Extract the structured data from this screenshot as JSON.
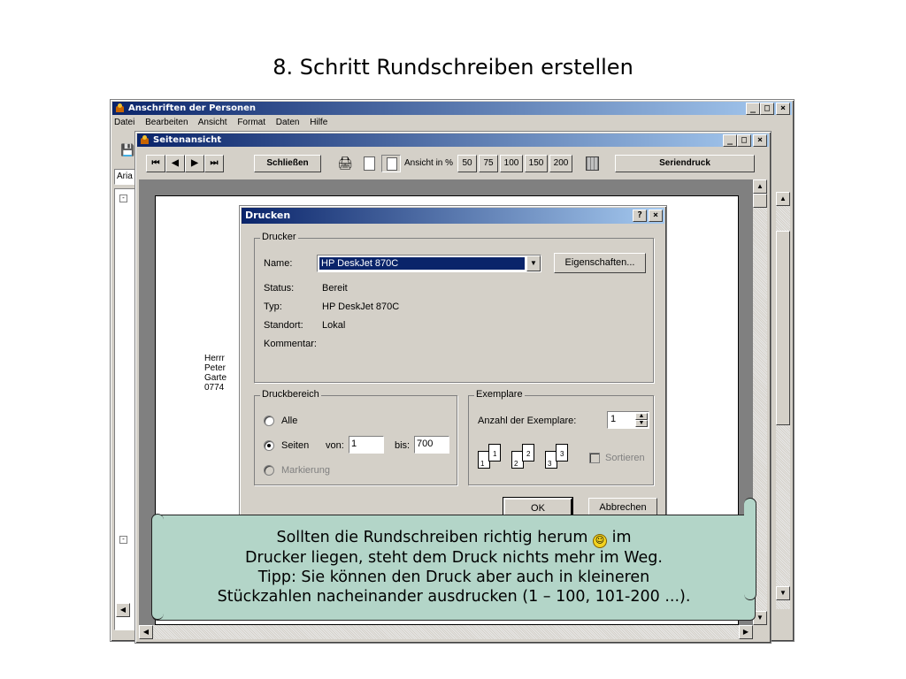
{
  "slide": {
    "title": "8. Schritt Rundschreiben erstellen"
  },
  "main_window": {
    "title": "Anschriften der Personen",
    "menu": [
      "Datei",
      "Bearbeiten",
      "Ansicht",
      "Format",
      "Daten",
      "Hilfe"
    ],
    "font_box": "Aria",
    "minimize": "_",
    "maximize": "□",
    "close": "×"
  },
  "preview_window": {
    "title": "Seitenansicht",
    "nav": {
      "first": "⏮",
      "prev": "◀",
      "next": "▶",
      "last": "⏭"
    },
    "close_label": "Schließen",
    "zoom_label": "Ansicht in %",
    "zoom_levels": [
      "50",
      "75",
      "100",
      "150",
      "200"
    ],
    "merge_label": "Seriendruck",
    "minimize": "_",
    "maximize": "□",
    "close": "×"
  },
  "document": {
    "address_lines": [
      "Herrr",
      "Peter",
      "Garte",
      "0774"
    ]
  },
  "print_dialog": {
    "title": "Drucken",
    "help": "?",
    "close": "×",
    "printer_group": "Drucker",
    "name_label": "Name:",
    "name_value": "HP DeskJet 870C",
    "properties_button": "Eigenschaften...",
    "status_label": "Status:",
    "status_value": "Bereit",
    "type_label": "Typ:",
    "type_value": "HP DeskJet 870C",
    "location_label": "Standort:",
    "location_value": "Lokal",
    "comment_label": "Kommentar:",
    "range_group": "Druckbereich",
    "all_label": "Alle",
    "pages_label": "Seiten",
    "from_label": "von:",
    "from_value": "1",
    "to_label": "bis:",
    "to_value": "700",
    "selection_label": "Markierung",
    "copies_group": "Exemplare",
    "copies_label": "Anzahl der Exemplare:",
    "copies_value": "1",
    "collate_label": "Sortieren",
    "collate_pages": [
      "1",
      "1",
      "2",
      "2",
      "3",
      "3"
    ],
    "ok": "OK",
    "cancel": "Abbrechen"
  },
  "callout": {
    "line1_before": "Sollten die Rundschreiben richtig herum",
    "line1_after": "im",
    "line2": "Drucker liegen, steht dem Druck nichts mehr im Weg.",
    "line3": "Tipp: Sie können den Druck aber auch in kleineren",
    "line4": "Stückzahlen nacheinander ausdrucken (1 – 100, 101-200 ...)."
  }
}
